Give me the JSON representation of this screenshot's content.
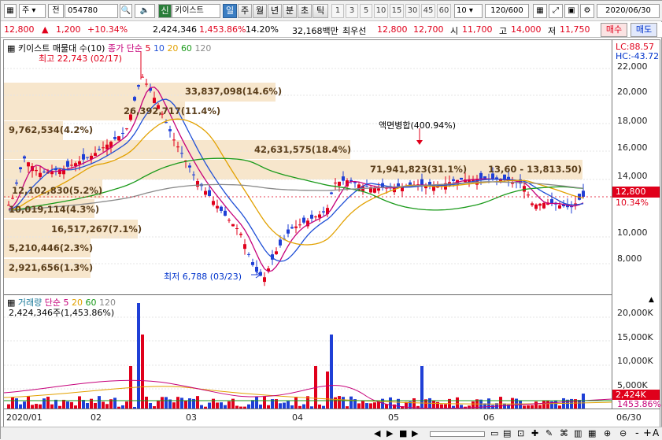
{
  "toolbar": {
    "code": "054780",
    "market_btn": "신",
    "name": "키이스트",
    "period_tabs": [
      "일",
      "주",
      "월",
      "년",
      "분",
      "초",
      "틱"
    ],
    "active_period": "일",
    "minute_opts": [
      "1",
      "3",
      "5",
      "10",
      "15",
      "30",
      "45",
      "60"
    ],
    "tick_value": "10",
    "count": "120/600",
    "date": "2020/06/30",
    "left_labels": [
      "주",
      "전"
    ]
  },
  "quote": {
    "price": "12,800",
    "change": "1,200",
    "change_pct": "+10.34%",
    "volume": "2,424,346",
    "vol_ratio": "1,453.86%",
    "turnover": "14.20%",
    "amount": "32,168백만",
    "priority_label": "최우선",
    "ask": "12,800",
    "bid": "12,700",
    "open_label": "시",
    "open": "11,700",
    "high_label": "고",
    "high": "14,000",
    "low_label": "저",
    "low": "11,750",
    "buy_btn": "매수",
    "sell_btn": "매도"
  },
  "main_panel": {
    "legend_title": "키이스트 매물대 수(10)",
    "legend_ma": "종가 단순",
    "ma_periods": [
      "5",
      "10",
      "20",
      "60",
      "120"
    ],
    "ma_colors": [
      "#e0001b",
      "#1f4fd6",
      "#e2a100",
      "#1a9a1a",
      "#8a8a8a"
    ],
    "lc": "LC:88.57",
    "hc": "HC:-43.72",
    "max_label": "최고 22,743 (02/17)",
    "min_label": "최저 6,788 (03/23)",
    "event_label": "액면병합(400.94%)",
    "price_tag": "12,800",
    "pct_tag": "10.34%",
    "yticks": [
      "22,000",
      "20,000",
      "18,000",
      "16,000",
      "14,000",
      "10,000",
      "8,000"
    ],
    "annotations": [
      "33,837,098(14.6%)",
      "26,392,717(11.4%)",
      "9,762,534(4.2%)",
      "42,631,575(18.4%)",
      "71,941,823(31.1%)",
      "13,60 - 13,813.50)",
      "12,102,830(5.2%)",
      "10,019,114(4.3%)",
      "16,517,267(7.1%)",
      "5,210,446(2.3%)",
      "2,921,656(1.3%)"
    ]
  },
  "volume_panel": {
    "legend_title": "거래량",
    "legend_ma": "단순",
    "ma_periods": [
      "5",
      "20",
      "60",
      "120"
    ],
    "sub_label": "2,424,346주(1,453.86%)",
    "yticks": [
      "20,000K",
      "15,000K",
      "10,000K",
      "5,000K"
    ],
    "vol_tag": "2,424K",
    "pct_tag": "1453.86%"
  },
  "xaxis": {
    "ticks": [
      "2020/01",
      "02",
      "03",
      "04",
      "05",
      "06"
    ],
    "end_date": "06/30"
  },
  "status": {
    "zoom_minus": "-",
    "zoom_plus": "+",
    "zoom_a": "A"
  }
}
